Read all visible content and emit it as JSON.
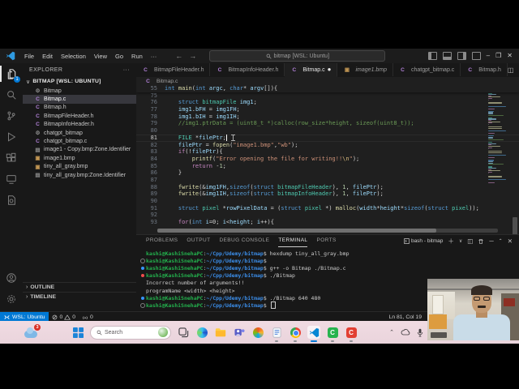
{
  "titlebar": {
    "menu": [
      "File",
      "Edit",
      "Selection",
      "View",
      "Go",
      "Run"
    ],
    "overflow": "···",
    "back_arrow": "←",
    "forward_arrow": "→",
    "search_text": "bitmap [WSL: Ubuntu]",
    "minimize": "–",
    "restore": "❐",
    "close": "✕"
  },
  "activity_bar": {
    "badge": "1",
    "items": [
      "explorer",
      "search",
      "source-control",
      "run-and-debug",
      "extensions",
      "remote-explorer",
      "wsl-targets"
    ],
    "bottom_items": [
      "accounts",
      "manage-settings"
    ]
  },
  "sidebar": {
    "title": "EXPLORER",
    "actions": "···",
    "section": "BITMAP [WSL: UBUNTU]",
    "files": [
      {
        "name": "Bitmap",
        "icon": "binary"
      },
      {
        "name": "Bitmap.c",
        "icon": "c",
        "selected": true
      },
      {
        "name": "Bitmap.h",
        "icon": "c"
      },
      {
        "name": "BitmapFileHeader.h",
        "icon": "c"
      },
      {
        "name": "BitmapInfoHeader.h",
        "icon": "c"
      },
      {
        "name": "chatgpt_bitmap",
        "icon": "binary"
      },
      {
        "name": "chatgpt_bitmap.c",
        "icon": "c"
      },
      {
        "name": "image1 - Copy.bmp:Zone.Identifier",
        "icon": "file"
      },
      {
        "name": "image1.bmp",
        "icon": "image"
      },
      {
        "name": "tiny_all_gray.bmp",
        "icon": "image"
      },
      {
        "name": "tiny_all_gray.bmp:Zone.Identifier",
        "icon": "file"
      }
    ],
    "outline": "OUTLINE",
    "timeline": "TIMELINE"
  },
  "editor_tabs": [
    {
      "label": "BitmapFileHeader.h",
      "icon": "c"
    },
    {
      "label": "BitmapInfoHeader.h",
      "icon": "c"
    },
    {
      "label": "Bitmap.c",
      "icon": "c",
      "active": true,
      "modified": true
    },
    {
      "label": "image1.bmp",
      "icon": "image",
      "preview": true
    },
    {
      "label": "chatgpt_bitmap.c",
      "icon": "c"
    },
    {
      "label": "Bitmap.h",
      "icon": "c"
    }
  ],
  "breadcrumb": {
    "file": "Bitmap.c"
  },
  "editor": {
    "sticky": {
      "num": "55",
      "tokens": [
        [
          "kw",
          "int"
        ],
        [
          "pl",
          " "
        ],
        [
          "fn",
          "main"
        ],
        [
          "pl",
          "("
        ],
        [
          "kw",
          "int"
        ],
        [
          "pl",
          " "
        ],
        [
          "var",
          "argc"
        ],
        [
          "pl",
          ", "
        ],
        [
          "kw",
          "char"
        ],
        [
          "pl",
          "* "
        ],
        [
          "var",
          "argv"
        ],
        [
          "pl",
          "[]){"
        ]
      ]
    },
    "lines": [
      {
        "num": "75",
        "tokens": []
      },
      {
        "num": "76",
        "tokens": [
          [
            "pl",
            "    "
          ],
          [
            "kw",
            "struct"
          ],
          [
            "pl",
            " "
          ],
          [
            "type",
            "bitmapFile"
          ],
          [
            "pl",
            " "
          ],
          [
            "var",
            "img1"
          ],
          [
            "pl",
            ";"
          ]
        ]
      },
      {
        "num": "77",
        "tokens": [
          [
            "pl",
            "    "
          ],
          [
            "var",
            "img1"
          ],
          [
            "pl",
            "."
          ],
          [
            "var",
            "bFH"
          ],
          [
            "pl",
            " = "
          ],
          [
            "var",
            "img1FH"
          ],
          [
            "pl",
            ";"
          ]
        ]
      },
      {
        "num": "78",
        "tokens": [
          [
            "pl",
            "    "
          ],
          [
            "var",
            "img1"
          ],
          [
            "pl",
            "."
          ],
          [
            "var",
            "bIH"
          ],
          [
            "pl",
            " = "
          ],
          [
            "var",
            "img1IH"
          ],
          [
            "pl",
            ";"
          ]
        ]
      },
      {
        "num": "79",
        "tokens": [
          [
            "pl",
            "    "
          ],
          [
            "com",
            "//img1.ptrData = (uint8_t *)calloc(row_size*height, sizeof(uint8_t));"
          ]
        ]
      },
      {
        "num": "80",
        "tokens": []
      },
      {
        "num": "81",
        "current": true,
        "cursor": true,
        "tokens": [
          [
            "pl",
            "    "
          ],
          [
            "type",
            "FILE"
          ],
          [
            "pl",
            " *"
          ],
          [
            "var",
            "filePtr"
          ],
          [
            "pl",
            ";"
          ]
        ]
      },
      {
        "num": "82",
        "tokens": [
          [
            "pl",
            "    "
          ],
          [
            "var",
            "filePtr"
          ],
          [
            "pl",
            " = "
          ],
          [
            "fn",
            "fopen"
          ],
          [
            "pl",
            "("
          ],
          [
            "str",
            "\"image1.bmp\""
          ],
          [
            "pl",
            ","
          ],
          [
            "str",
            "\"wb\""
          ],
          [
            "pl",
            ");"
          ]
        ]
      },
      {
        "num": "83",
        "tokens": [
          [
            "pl",
            "    "
          ],
          [
            "ctl",
            "if"
          ],
          [
            "pl",
            "(!"
          ],
          [
            "var",
            "filePtr"
          ],
          [
            "pl",
            "){"
          ]
        ]
      },
      {
        "num": "84",
        "tokens": [
          [
            "pl",
            "        "
          ],
          [
            "fn",
            "printf"
          ],
          [
            "pl",
            "("
          ],
          [
            "str",
            "\"Error opening the file for writing!!"
          ],
          [
            "esc",
            "\\n"
          ],
          [
            "str",
            "\""
          ],
          [
            "pl",
            ");"
          ]
        ]
      },
      {
        "num": "85",
        "tokens": [
          [
            "pl",
            "        "
          ],
          [
            "ctl",
            "return"
          ],
          [
            "pl",
            " -"
          ],
          [
            "cnum",
            "1"
          ],
          [
            "pl",
            ";"
          ]
        ]
      },
      {
        "num": "86",
        "tokens": [
          [
            "pl",
            "    }"
          ]
        ]
      },
      {
        "num": "87",
        "tokens": []
      },
      {
        "num": "88",
        "tokens": [
          [
            "pl",
            "    "
          ],
          [
            "fn",
            "fwrite"
          ],
          [
            "pl",
            "(&"
          ],
          [
            "var",
            "img1FH"
          ],
          [
            "pl",
            ","
          ],
          [
            "kw",
            "sizeof"
          ],
          [
            "pl",
            "("
          ],
          [
            "kw",
            "struct"
          ],
          [
            "pl",
            " "
          ],
          [
            "type",
            "bitmapFileHeader"
          ],
          [
            "pl",
            "), "
          ],
          [
            "cnum",
            "1"
          ],
          [
            "pl",
            ", "
          ],
          [
            "var",
            "filePtr"
          ],
          [
            "pl",
            ");"
          ]
        ]
      },
      {
        "num": "89",
        "tokens": [
          [
            "pl",
            "    "
          ],
          [
            "fn",
            "fwrite"
          ],
          [
            "pl",
            "(&"
          ],
          [
            "var",
            "img1IH"
          ],
          [
            "pl",
            ","
          ],
          [
            "kw",
            "sizeof"
          ],
          [
            "pl",
            "("
          ],
          [
            "kw",
            "struct"
          ],
          [
            "pl",
            " "
          ],
          [
            "type",
            "bitmapInfoHeader"
          ],
          [
            "pl",
            "), "
          ],
          [
            "cnum",
            "1"
          ],
          [
            "pl",
            ", "
          ],
          [
            "var",
            "filePtr"
          ],
          [
            "pl",
            ");"
          ]
        ]
      },
      {
        "num": "90",
        "tokens": []
      },
      {
        "num": "91",
        "tokens": [
          [
            "pl",
            "    "
          ],
          [
            "kw",
            "struct"
          ],
          [
            "pl",
            " "
          ],
          [
            "type",
            "pixel"
          ],
          [
            "pl",
            " *"
          ],
          [
            "var",
            "rowPixelData"
          ],
          [
            "pl",
            " = ("
          ],
          [
            "kw",
            "struct"
          ],
          [
            "pl",
            " "
          ],
          [
            "type",
            "pixel"
          ],
          [
            "pl",
            " *) "
          ],
          [
            "fn",
            "malloc"
          ],
          [
            "pl",
            "("
          ],
          [
            "var",
            "width"
          ],
          [
            "pl",
            "*"
          ],
          [
            "var",
            "height"
          ],
          [
            "pl",
            "*"
          ],
          [
            "kw",
            "sizeof"
          ],
          [
            "pl",
            "("
          ],
          [
            "kw",
            "struct"
          ],
          [
            "pl",
            " "
          ],
          [
            "type",
            "pixel"
          ],
          [
            "pl",
            "));"
          ]
        ]
      },
      {
        "num": "92",
        "tokens": []
      },
      {
        "num": "93",
        "tokens": [
          [
            "pl",
            "    "
          ],
          [
            "ctl",
            "for"
          ],
          [
            "pl",
            "("
          ],
          [
            "kw",
            "int"
          ],
          [
            "pl",
            " "
          ],
          [
            "var",
            "i"
          ],
          [
            "pl",
            "=0; "
          ],
          [
            "var",
            "i"
          ],
          [
            "pl",
            "<"
          ],
          [
            "var",
            "height"
          ],
          [
            "pl",
            "; "
          ],
          [
            "var",
            "i"
          ],
          [
            "pl",
            "++){"
          ]
        ]
      }
    ]
  },
  "panel": {
    "tabs": [
      {
        "label": "PROBLEMS"
      },
      {
        "label": "OUTPUT"
      },
      {
        "label": "DEBUG CONSOLE"
      },
      {
        "label": "TERMINAL",
        "active": true
      },
      {
        "label": "PORTS"
      }
    ],
    "terminal_title": "bash - bitmap",
    "action_icons": [
      "new-terminal",
      "launch-profile-dropdown",
      "split-terminal",
      "kill-terminal",
      "minimize-panel",
      "maximize-panel",
      "close-panel"
    ],
    "prompt": {
      "user": "kashi@KashiSnehaPC",
      "sep": ":",
      "path": "~/Cpp/Udemy/bitmap",
      "dollar": "$ "
    },
    "lines": [
      {
        "type": "cmd",
        "ind": null,
        "text": "hexdump tiny_all_gray.bmp"
      },
      {
        "type": "cmd",
        "ind": "idle",
        "text": ""
      },
      {
        "type": "cmd",
        "ind": "ok",
        "text": "g++ -o Bitmap ./Bitmap.c"
      },
      {
        "type": "cmd",
        "ind": "err",
        "text": "./Bitmap"
      },
      {
        "type": "out",
        "text": "Incorrect number of arguments!!"
      },
      {
        "type": "out",
        "text": "programName <width> <height>"
      },
      {
        "type": "cmd",
        "ind": "ok",
        "text": "./Bitmap 640 480"
      },
      {
        "type": "cmd",
        "ind": "idle",
        "text": "",
        "cursor": true
      }
    ]
  },
  "status_bar": {
    "remote": "WSL: Ubuntu",
    "errors": "0",
    "warnings": "0",
    "ports": "0",
    "cursor_pos": "Ln 81, Col 19"
  },
  "taskbar": {
    "widget_badge": "3",
    "search_label": "Search",
    "icons": [
      "widgets",
      "start",
      "search",
      "task-view",
      "edge",
      "file-explorer",
      "teams",
      "copilot",
      "notepad",
      "chrome",
      "vscode",
      "camtasia",
      "recorder"
    ],
    "tray_icons": [
      "show-hidden",
      "onedrive",
      "microphone"
    ]
  },
  "colors": {
    "accent": "#0078d4",
    "remote_badge": "#0078d4",
    "selection_row": "#37373d"
  }
}
